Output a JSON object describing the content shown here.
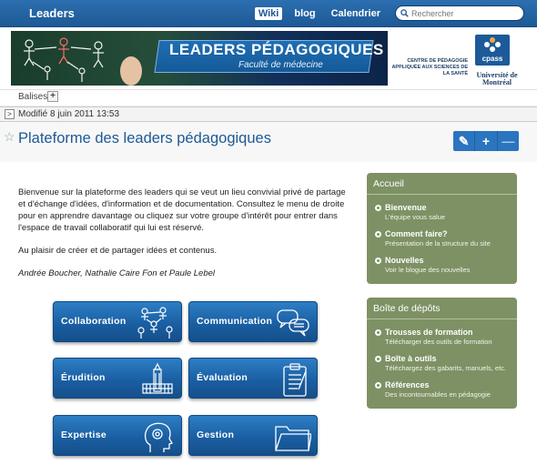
{
  "topbar": {
    "site_name": "Leaders",
    "nav": [
      "Wiki",
      "blog",
      "Calendrier"
    ],
    "search_placeholder": "Rechercher"
  },
  "banner": {
    "title": "LEADERS PÉDAGOGIQUES",
    "subtitle": "Faculté de médecine",
    "centre": "CENTRE DE PÉDAGOGIE APPLIQUÉE AUX SCIENCES DE LA SANTÉ",
    "cpass": "cpass",
    "university": "Université de Montréal"
  },
  "tags": {
    "label": "Balises",
    "add": "+"
  },
  "modified": {
    "toggle": ">",
    "text": "Modifié 8 juin 2011 13:53"
  },
  "page": {
    "title": "Plateforme des leaders pédagogiques",
    "tools": [
      "✎",
      "+",
      "—"
    ]
  },
  "intro": {
    "p1": "Bienvenue sur la plateforme des leaders qui se veut un lieu convivial privé de partage et d'échange d'idées, d'information et de documentation. Consultez le menu de droite pour en apprendre davantage ou cliquez sur votre groupe d'intérêt pour entrer dans l'espace de travail collaboratif qui lui est réservé.",
    "p2": "Au plaisir de créer et de partager idées et contenus.",
    "authors": "Andrée Boucher, Nathalie Caire Fon et Paule Lebel"
  },
  "tiles": {
    "collaboration": "Collaboration",
    "communication": "Communication",
    "erudition": "Érudition",
    "evaluation": "Évaluation",
    "expertise": "Expertise",
    "gestion": "Gestion"
  },
  "sidebar": {
    "accueil": {
      "title": "Accueil",
      "items": [
        {
          "title": "Bienvenue",
          "sub": "L'équipe vous salue"
        },
        {
          "title": "Comment faire?",
          "sub": "Présentation de la structure du site"
        },
        {
          "title": "Nouvelles",
          "sub": "Voir le blogue des nouvelles"
        }
      ]
    },
    "depots": {
      "title": "Boîte de dépôts",
      "items": [
        {
          "title": "Trousses de formation",
          "sub": "Télécharger des outils de formation"
        },
        {
          "title": "Boîte à outils",
          "sub": "Téléchargez des gabarits, manuels, etc."
        },
        {
          "title": "Références",
          "sub": "Des incontournables en pédagogie"
        }
      ]
    }
  },
  "colors": {
    "topbar": "#1d5996",
    "tile": "#1a5fa3",
    "sidebar": "#7e9164",
    "title": "#1d5996"
  }
}
